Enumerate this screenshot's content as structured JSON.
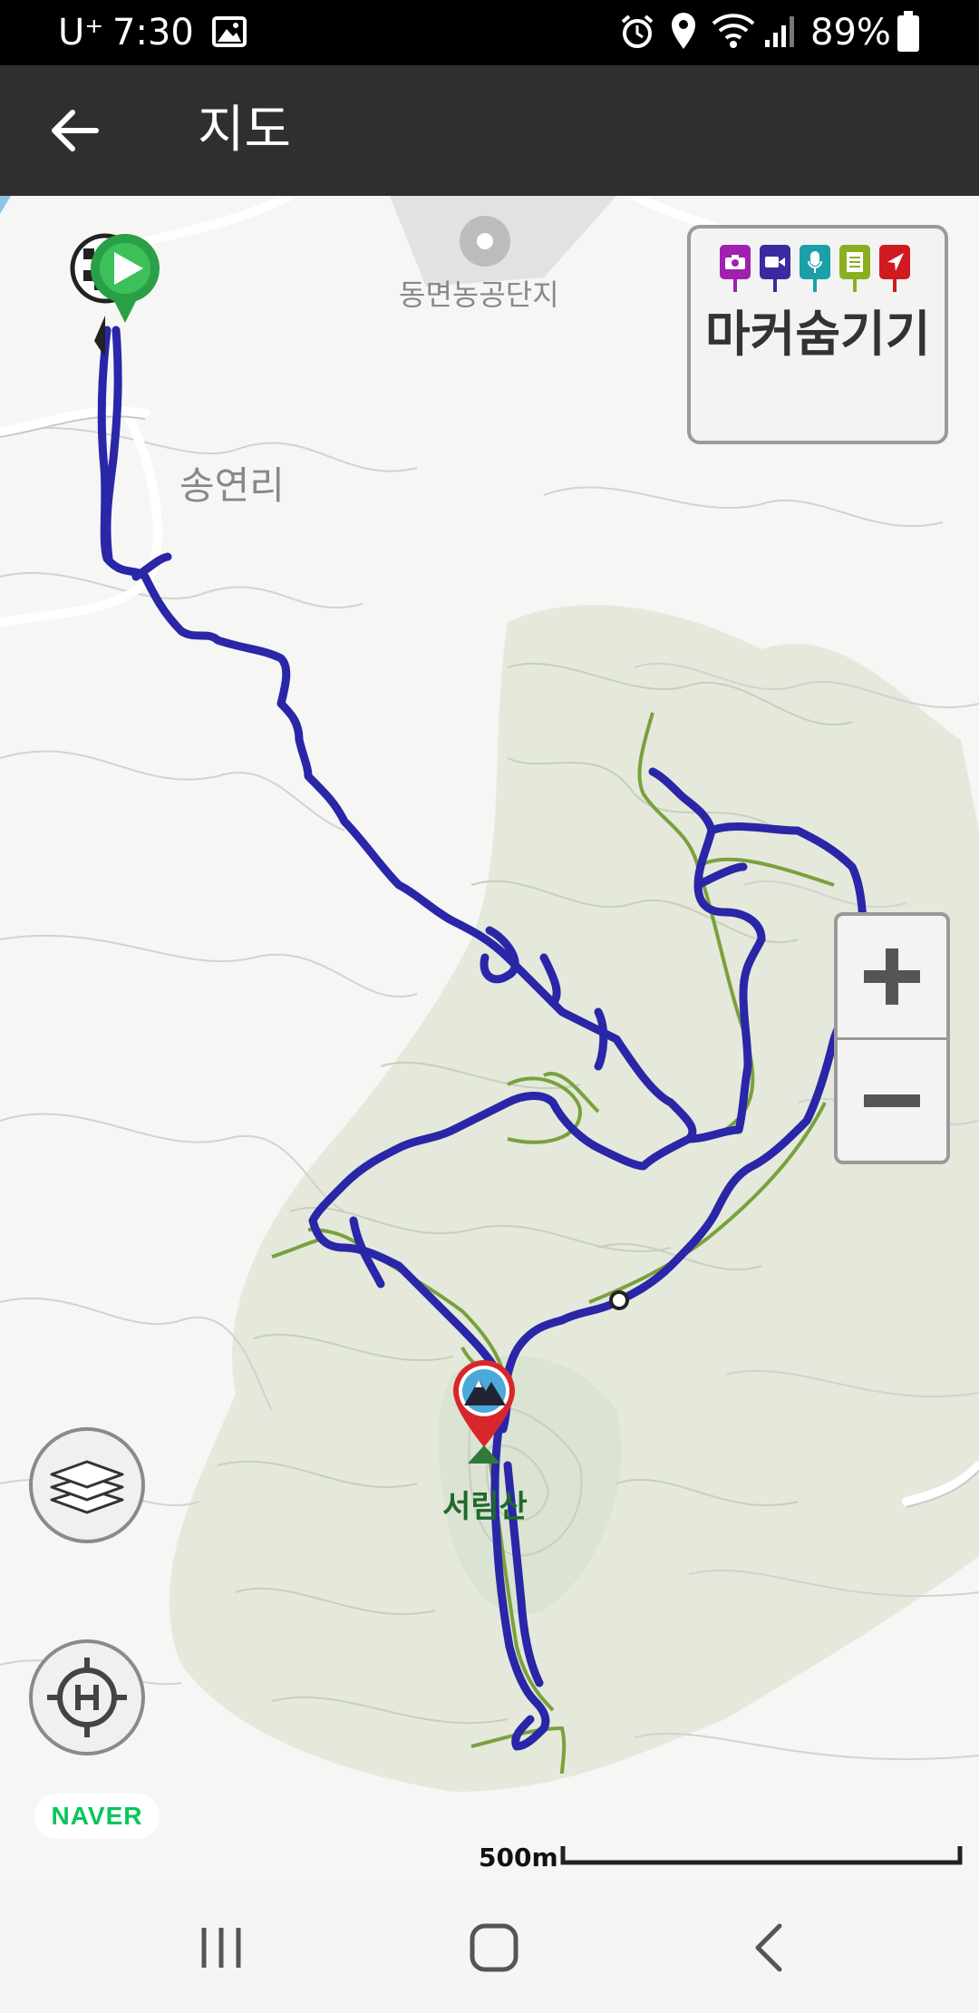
{
  "status_bar": {
    "carrier": "U⁺",
    "time": "7:30",
    "battery_percent": "89%",
    "icons": [
      "image-icon",
      "alarm-icon",
      "location-icon",
      "wifi-icon",
      "signal-icon",
      "battery-icon"
    ]
  },
  "app_bar": {
    "title": "지도",
    "back_icon": "arrow-left-icon"
  },
  "map": {
    "place_labels": {
      "industrial_complex": "동면농공단지",
      "village": "송연리",
      "mountain": "서림산"
    },
    "track_color": "#2a26a8",
    "trail_color": "#7aa13c",
    "scale_label": "500m",
    "attribution": "NAVER",
    "attribution_color": "#03c75a"
  },
  "marker_panel": {
    "label": "마커숨기기",
    "icons": [
      {
        "name": "camera-icon",
        "color": "#a020b0"
      },
      {
        "name": "video-icon",
        "color": "#3a2aa0"
      },
      {
        "name": "microphone-icon",
        "color": "#1aa0a8"
      },
      {
        "name": "memo-icon",
        "color": "#8ab020"
      },
      {
        "name": "navigation-icon",
        "color": "#d01a20"
      }
    ]
  },
  "zoom_controls": {
    "zoom_in_icon": "plus-icon",
    "zoom_out_icon": "minus-icon"
  },
  "map_buttons": {
    "layers_icon": "layers-icon",
    "location_icon": "crosshair-h-icon"
  },
  "nav_bar": {
    "icons": [
      "recent-apps-icon",
      "home-icon",
      "back-icon"
    ]
  }
}
